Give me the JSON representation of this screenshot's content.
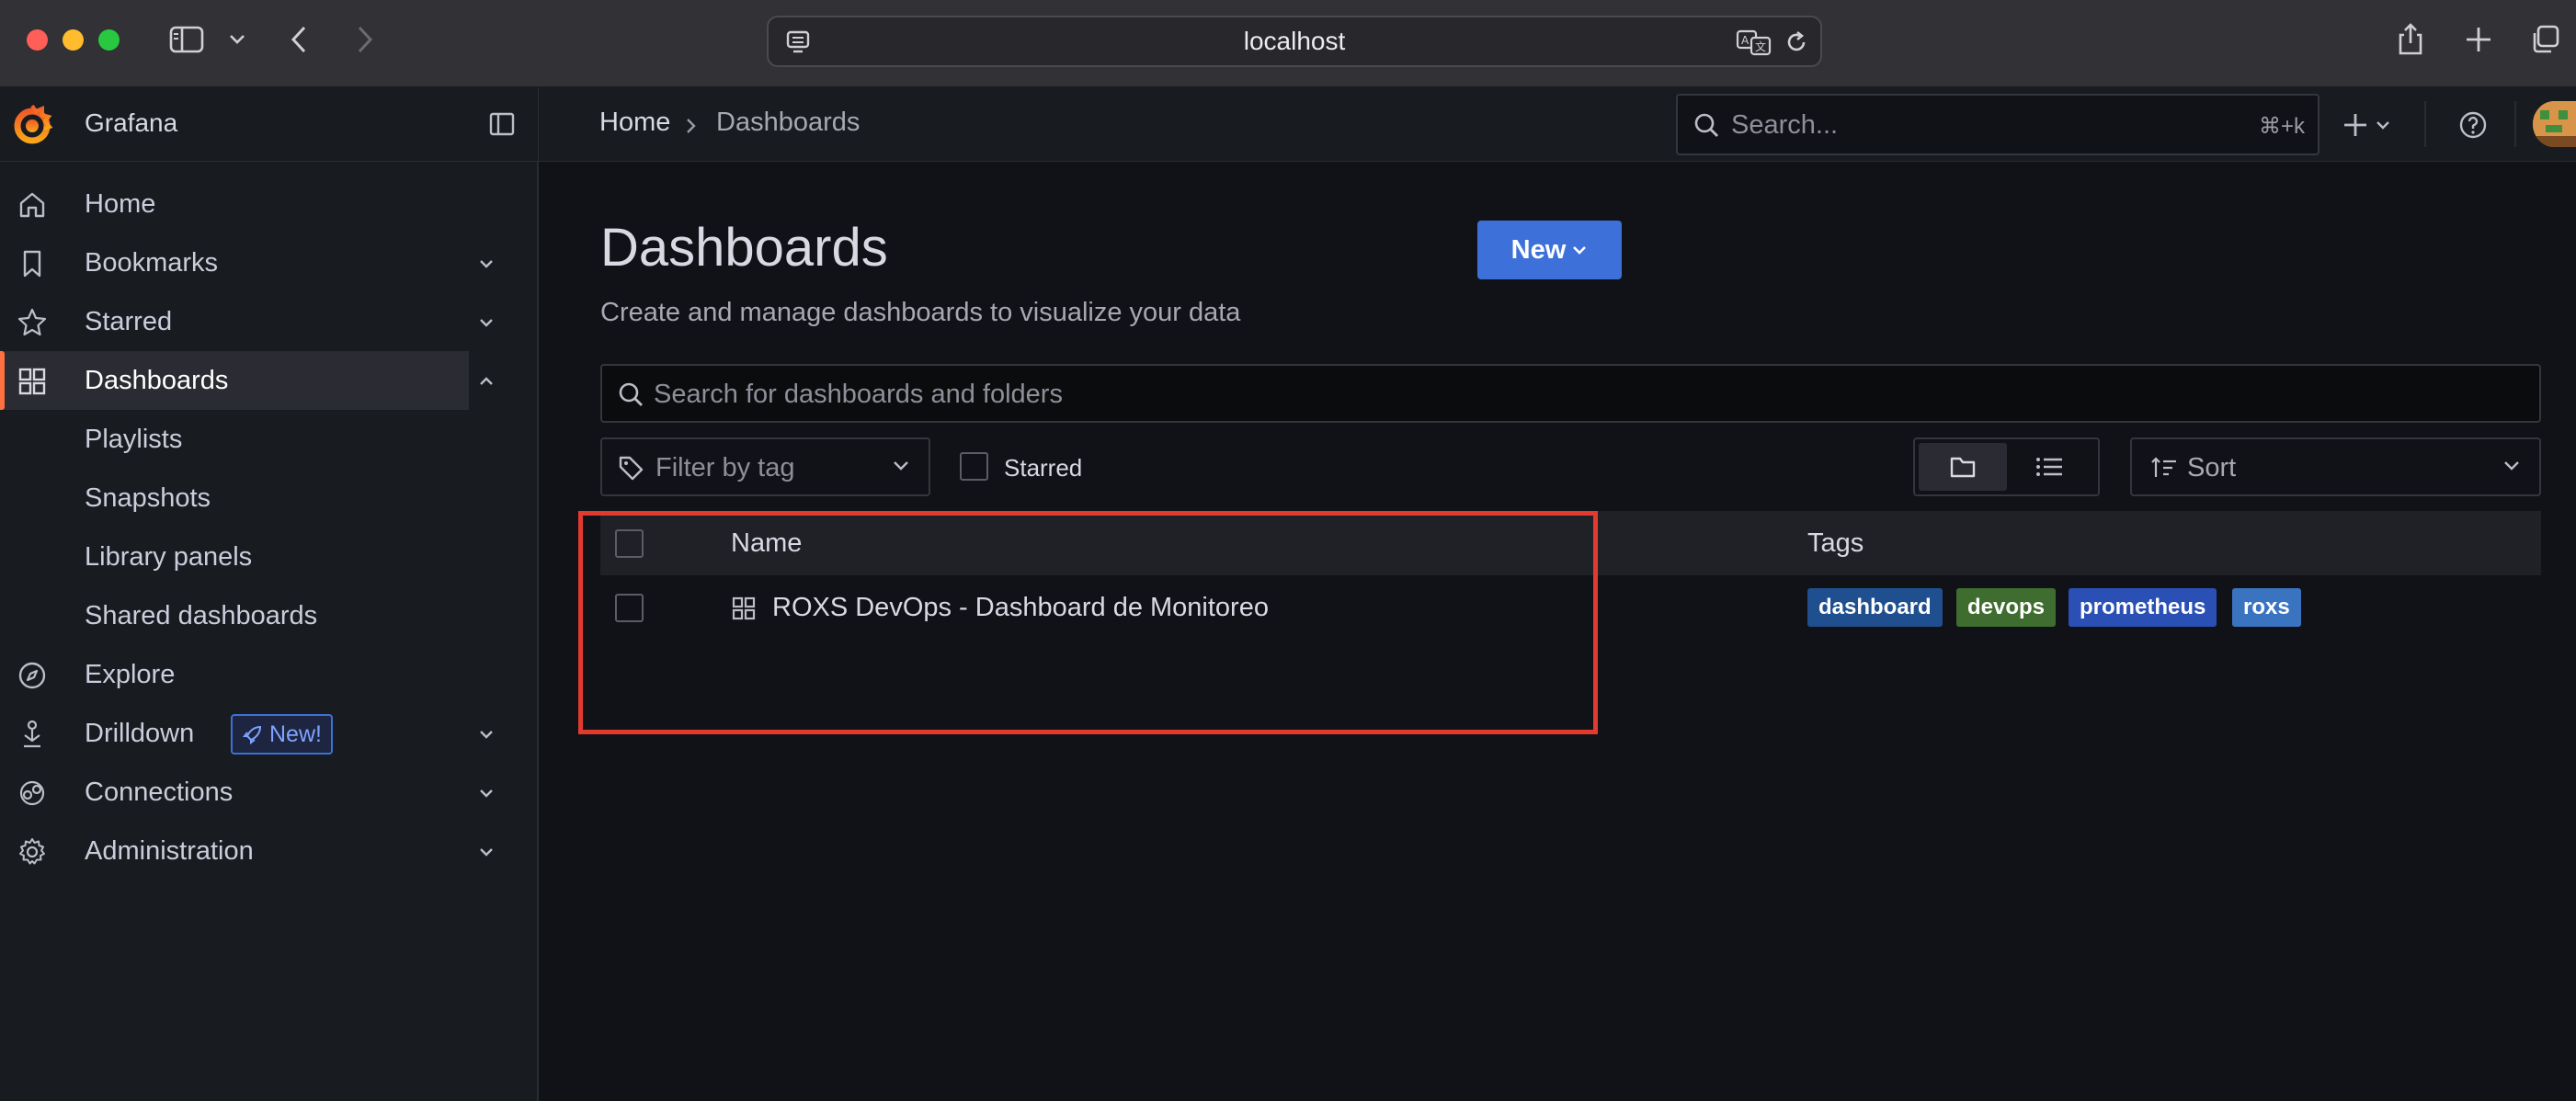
{
  "browser": {
    "url": "localhost"
  },
  "app": {
    "name": "Grafana"
  },
  "breadcrumb": {
    "home": "Home",
    "current": "Dashboards"
  },
  "topbar": {
    "search_placeholder": "Search...",
    "shortcut": "⌘+k"
  },
  "sidebar": {
    "items": [
      {
        "label": "Home",
        "icon": "home-icon"
      },
      {
        "label": "Bookmarks",
        "icon": "bookmark-icon"
      },
      {
        "label": "Starred",
        "icon": "star-icon"
      },
      {
        "label": "Dashboards",
        "icon": "apps-icon"
      },
      {
        "label": "Explore",
        "icon": "compass-icon"
      },
      {
        "label": "Drilldown",
        "icon": "drilldown-icon"
      },
      {
        "label": "Connections",
        "icon": "connections-icon"
      },
      {
        "label": "Administration",
        "icon": "gear-icon"
      }
    ],
    "dashboards_subitems": [
      "Playlists",
      "Snapshots",
      "Library panels",
      "Shared dashboards"
    ],
    "new_badge": "New!"
  },
  "page": {
    "title": "Dashboards",
    "subtitle": "Create and manage dashboards to visualize your data",
    "new_button": "New",
    "search_placeholder": "Search for dashboards and folders",
    "filter_tag_placeholder": "Filter by tag",
    "starred_label": "Starred",
    "sort_placeholder": "Sort"
  },
  "table": {
    "columns": {
      "name": "Name",
      "tags": "Tags"
    },
    "rows": [
      {
        "title": "ROXS DevOps - Dashboard de Monitoreo",
        "tags": [
          {
            "label": "dashboard",
            "color": "#1f4f8f"
          },
          {
            "label": "devops",
            "color": "#3f6d2f"
          },
          {
            "label": "prometheus",
            "color": "#2a4fb5"
          },
          {
            "label": "roxs",
            "color": "#3a74c0"
          }
        ]
      }
    ]
  },
  "colors": {
    "accent": "#ff7041",
    "primary": "#3d71d9",
    "highlight": "#e23a2f"
  }
}
